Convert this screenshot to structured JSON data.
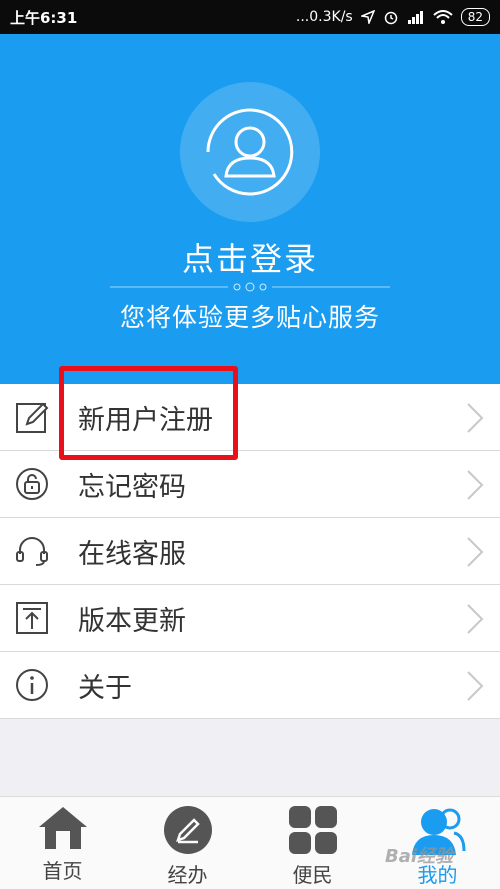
{
  "status_bar": {
    "time": "上午6:31",
    "speed": "...0.3K/s",
    "battery": "82"
  },
  "header": {
    "login_text": "点击登录",
    "subtitle": "您将体验更多贴心服务"
  },
  "menu": {
    "items": [
      {
        "label": "新用户注册",
        "icon": "edit-icon"
      },
      {
        "label": "忘记密码",
        "icon": "lock-icon"
      },
      {
        "label": "在线客服",
        "icon": "headset-icon"
      },
      {
        "label": "版本更新",
        "icon": "upload-icon"
      },
      {
        "label": "关于",
        "icon": "info-icon"
      }
    ]
  },
  "tabbar": {
    "items": [
      {
        "label": "首页",
        "icon": "home-icon"
      },
      {
        "label": "经办",
        "icon": "pen-icon"
      },
      {
        "label": "便民",
        "icon": "grid-icon"
      },
      {
        "label": "我的",
        "icon": "user-icon",
        "active": true
      }
    ]
  },
  "watermark": "Bai经验",
  "colors": {
    "primary": "#1a9cf0",
    "highlight": "#e8101a"
  }
}
